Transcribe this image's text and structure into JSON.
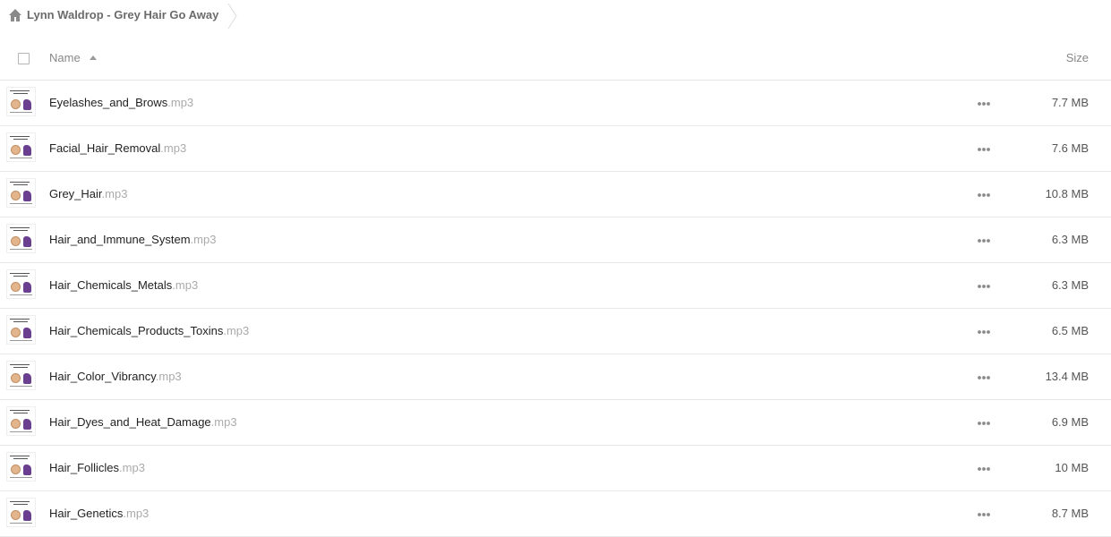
{
  "breadcrumb": {
    "icon": "home-icon",
    "label": "Lynn Waldrop - Grey Hair Go Away",
    "separator_icon": "chevron-right-icon"
  },
  "header": {
    "name_label": "Name",
    "size_label": "Size",
    "sort_icon": "sort-ascending-icon"
  },
  "files": [
    {
      "name": "Eyelashes_and_Brows",
      "ext": ".mp3",
      "size": "7.7 MB"
    },
    {
      "name": "Facial_Hair_Removal",
      "ext": ".mp3",
      "size": "7.6 MB"
    },
    {
      "name": "Grey_Hair",
      "ext": ".mp3",
      "size": "10.8 MB"
    },
    {
      "name": "Hair_and_Immune_System",
      "ext": ".mp3",
      "size": "6.3 MB"
    },
    {
      "name": "Hair_Chemicals_Metals",
      "ext": ".mp3",
      "size": "6.3 MB"
    },
    {
      "name": "Hair_Chemicals_Products_Toxins",
      "ext": ".mp3",
      "size": "6.5 MB"
    },
    {
      "name": "Hair_Color_Vibrancy",
      "ext": ".mp3",
      "size": "13.4 MB"
    },
    {
      "name": "Hair_Dyes_and_Heat_Damage",
      "ext": ".mp3",
      "size": "6.9 MB"
    },
    {
      "name": "Hair_Follicles",
      "ext": ".mp3",
      "size": "10 MB"
    },
    {
      "name": "Hair_Genetics",
      "ext": ".mp3",
      "size": "8.7 MB"
    }
  ],
  "colors": {
    "ext_text": "#aaaaaa",
    "divider": "#e8e8e8",
    "icon_gray": "#8a8a8a"
  }
}
